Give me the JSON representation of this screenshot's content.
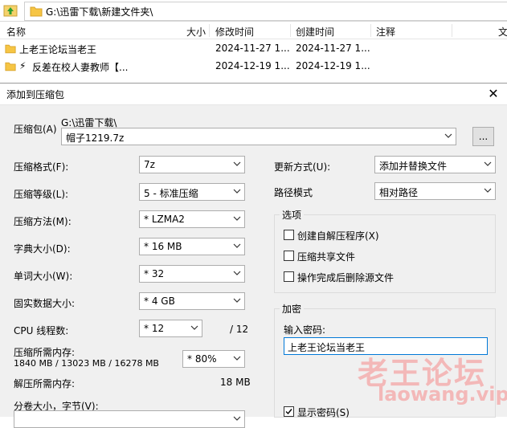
{
  "explorer": {
    "address": "G:\\迅雷下载\\新建文件夹\\",
    "columns": [
      "名称",
      "大小",
      "修改时间",
      "创建时间",
      "注释",
      "文"
    ],
    "rows": [
      {
        "name": "上老王论坛当老王",
        "modified": "2024-11-27 1...",
        "created": "2024-11-27 1..."
      },
      {
        "name": "反差在校人妻教师【...",
        "modified": "2024-12-19 1...",
        "created": "2024-12-19 1..."
      }
    ]
  },
  "dialog": {
    "title": "添加到压缩包",
    "archive_label": "压缩包(A)",
    "archive_path": "G:\\迅雷下载\\",
    "archive_name": "帽子1219.7z",
    "browse": "...",
    "format_label": "压缩格式(F):",
    "format_value": "7z",
    "level_label": "压缩等级(L):",
    "level_value": "5 - 标准压缩",
    "method_label": "压缩方法(M):",
    "method_value": "* LZMA2",
    "dict_label": "字典大小(D):",
    "dict_value": "* 16 MB",
    "word_label": "单词大小(W):",
    "word_value": "* 32",
    "solid_label": "固实数据大小:",
    "solid_value": "* 4 GB",
    "cpu_label": "CPU 线程数:",
    "cpu_value": "* 12",
    "cpu_max": "/ 12",
    "mem_label": "压缩所需内存:",
    "mem_value": "1840 MB / 13023 MB / 16278 MB",
    "mem_pct": "* 80%",
    "dmem_label": "解压所需内存:",
    "dmem_value": "18 MB",
    "split_label": "分卷大小，字节(V):",
    "update_label": "更新方式(U):",
    "update_value": "添加并替换文件",
    "pathmode_label": "路径模式",
    "pathmode_value": "相对路径",
    "options_title": "选项",
    "opt_sfx": "创建自解压程序(X)",
    "opt_shared": "压缩共享文件",
    "opt_delete": "操作完成后删除源文件",
    "enc_title": "加密",
    "pw_label": "输入密码:",
    "pw_value": "上老王论坛当老王",
    "show_pw": "显示密码(S)"
  },
  "watermark": {
    "cn": "老王论坛",
    "en": "laowang.vip"
  }
}
